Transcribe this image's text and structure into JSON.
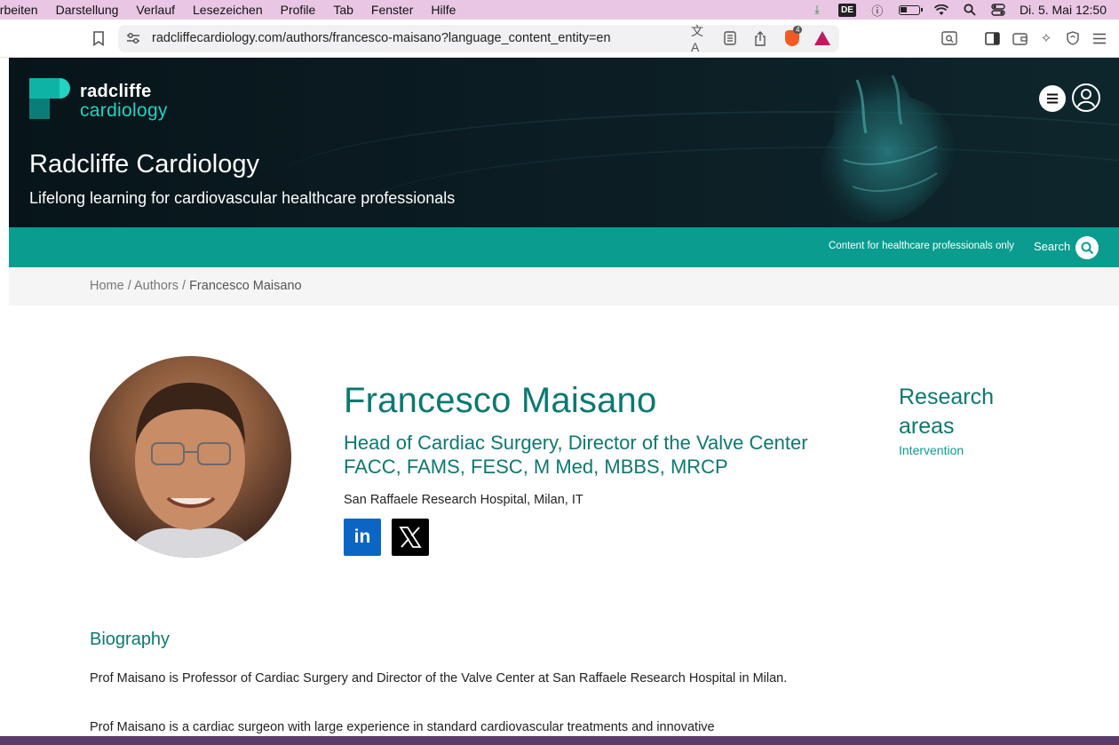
{
  "menubar": {
    "items": [
      "arbeiten",
      "Darstellung",
      "Verlauf",
      "Lesezeichen",
      "Profile",
      "Tab",
      "Fenster",
      "Hilfe"
    ],
    "keyboard_layout": "DE",
    "datetime": "Di. 5. Mai  12:50"
  },
  "browser": {
    "url": "radcliffecardiology.com/authors/francesco-maisano?language_content_entity=en",
    "shields_count": "4"
  },
  "site": {
    "logo_line1": "radcliffe",
    "logo_line2": "cardiology",
    "title": "Radcliffe Cardiology",
    "tagline": "Lifelong learning for cardiovascular healthcare professionals",
    "hcp_notice": "Content for healthcare professionals only",
    "search_label": "Search"
  },
  "breadcrumb": {
    "home": "Home",
    "sep": " / ",
    "authors": "Authors",
    "current": "Francesco Maisano"
  },
  "author": {
    "name": "Francesco Maisano",
    "role_line1": "Head of Cardiac Surgery, Director of the Valve Center",
    "role_line2": "FACC, FAMS, FESC, M Med, MBBS, MRCP",
    "affiliation": "San Raffaele Research Hospital, Milan, IT",
    "linkedin_label": "in"
  },
  "research": {
    "title_line1": "Research",
    "title_line2": "areas",
    "items": [
      "Intervention"
    ]
  },
  "biography": {
    "title": "Biography",
    "p1": "Prof Maisano is Professor of Cardiac Surgery and Director of the Valve Center at San Raffaele Research Hospital in Milan.",
    "p2": "Prof Maisano is a cardiac surgeon with large experience in standard cardiovascular treatments and innovative"
  },
  "colors": {
    "brand_teal": "#0a9c8f",
    "heading_teal": "#0d7872",
    "hero_dark": "#0c1e24",
    "menubar_pink": "#e9c7e4"
  }
}
